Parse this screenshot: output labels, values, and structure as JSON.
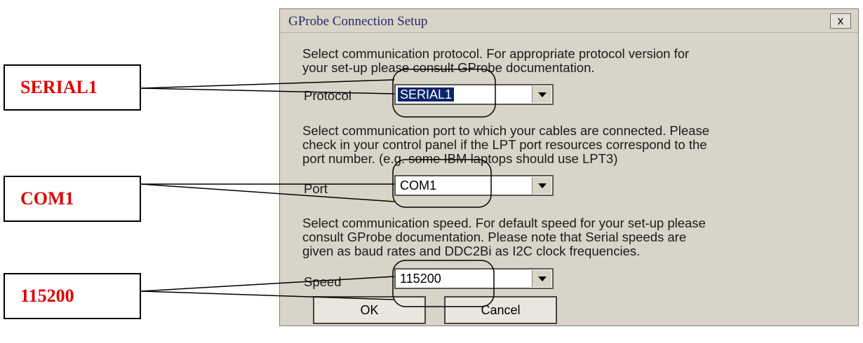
{
  "callouts": {
    "protocol": "SERIAL1",
    "port": "COM1",
    "speed": "115200",
    "text_color": "#e00000"
  },
  "dialog": {
    "title": "GProbe Connection Setup",
    "close_label": "x",
    "protocol_help_line1": "Select communication protocol. For appropriate protocol version for",
    "protocol_help_line2": "your set-up please consult GProbe documentation.",
    "protocol_label": "Protocol",
    "protocol_value": "SERIAL1",
    "port_help_line1": "Select communication port to which your cables are connected. Please",
    "port_help_line2": "check in your control panel if the LPT port resources correspond to the",
    "port_help_line3": "port number. (e.g. some IBM laptops should use LPT3)",
    "port_label": "Port",
    "port_value": "COM1",
    "speed_help_line1": "Select communication speed. For default speed for your set-up please",
    "speed_help_line2": "consult GProbe documentation. Please note that Serial speeds are",
    "speed_help_line3": "given as baud rates and DDC2Bi as I2C clock frequencies.",
    "speed_label": "Speed",
    "speed_value": "115200",
    "ok_label": "OK",
    "cancel_label": "Cancel",
    "selection_color": "#0a246a"
  }
}
